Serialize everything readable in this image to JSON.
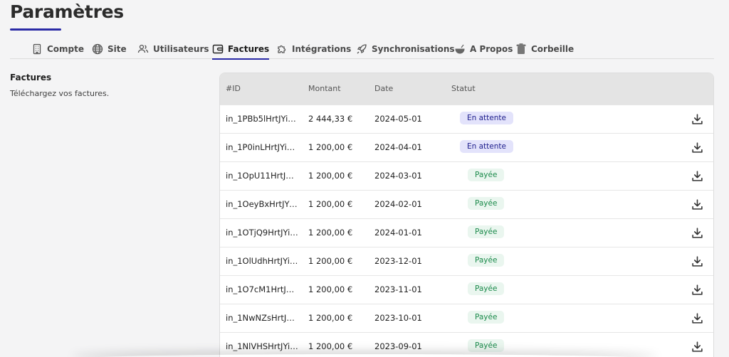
{
  "page": {
    "title": "Paramètres"
  },
  "tabs": [
    {
      "label": "Compte",
      "icon": "building-icon"
    },
    {
      "label": "Site",
      "icon": "globe-icon"
    },
    {
      "label": "Utilisateurs",
      "icon": "users-icon"
    },
    {
      "label": "Factures",
      "icon": "wallet-icon",
      "active": true
    },
    {
      "label": "Intégrations",
      "icon": "puzzle-icon"
    },
    {
      "label": "Synchronisations",
      "icon": "rocket-icon"
    },
    {
      "label": "A Propos",
      "icon": "bowl-icon"
    },
    {
      "label": "Corbeille",
      "icon": "trash-icon"
    }
  ],
  "section": {
    "title": "Factures",
    "description": "Téléchargez vos factures."
  },
  "table": {
    "headers": {
      "id": "#ID",
      "amount": "Montant",
      "date": "Date",
      "status": "Statut"
    },
    "rows": [
      {
        "id": "in_1PBb5lHrtJYiyVk…",
        "amount": "2 444,33 €",
        "date": "2024-05-01",
        "status": "En attente"
      },
      {
        "id": "in_1P0inLHrtJYiyVk…",
        "amount": "1 200,00 €",
        "date": "2024-04-01",
        "status": "En attente"
      },
      {
        "id": "in_1OpU11HrtJYiyVk…",
        "amount": "1 200,00 €",
        "date": "2024-03-01",
        "status": "Payée"
      },
      {
        "id": "in_1OeyBxHrtJYiyV…",
        "amount": "1 200,00 €",
        "date": "2024-02-01",
        "status": "Payée"
      },
      {
        "id": "in_1OTjQ9HrtJYiyV…",
        "amount": "1 200,00 €",
        "date": "2024-01-01",
        "status": "Payée"
      },
      {
        "id": "in_1OlUdhHrtJYiyV…",
        "amount": "1 200,00 €",
        "date": "2023-12-01",
        "status": "Payée"
      },
      {
        "id": "in_1O7cM1HrtJYiyV…",
        "amount": "1 200,00 €",
        "date": "2023-11-01",
        "status": "Payée"
      },
      {
        "id": "in_1NwNZsHrtJYiyV…",
        "amount": "1 200,00 €",
        "date": "2023-10-01",
        "status": "Payée"
      },
      {
        "id": "in_1NlVHSHrtJYiyVk…",
        "amount": "1 200,00 €",
        "date": "2023-09-01",
        "status": "Payée"
      }
    ]
  },
  "colors": {
    "accent": "#2a2aa6",
    "pending_bg": "#e3e3fb",
    "pending_text": "#1d1d8c",
    "paid_bg": "#eaf6ef",
    "paid_text": "#1a8a4a"
  }
}
